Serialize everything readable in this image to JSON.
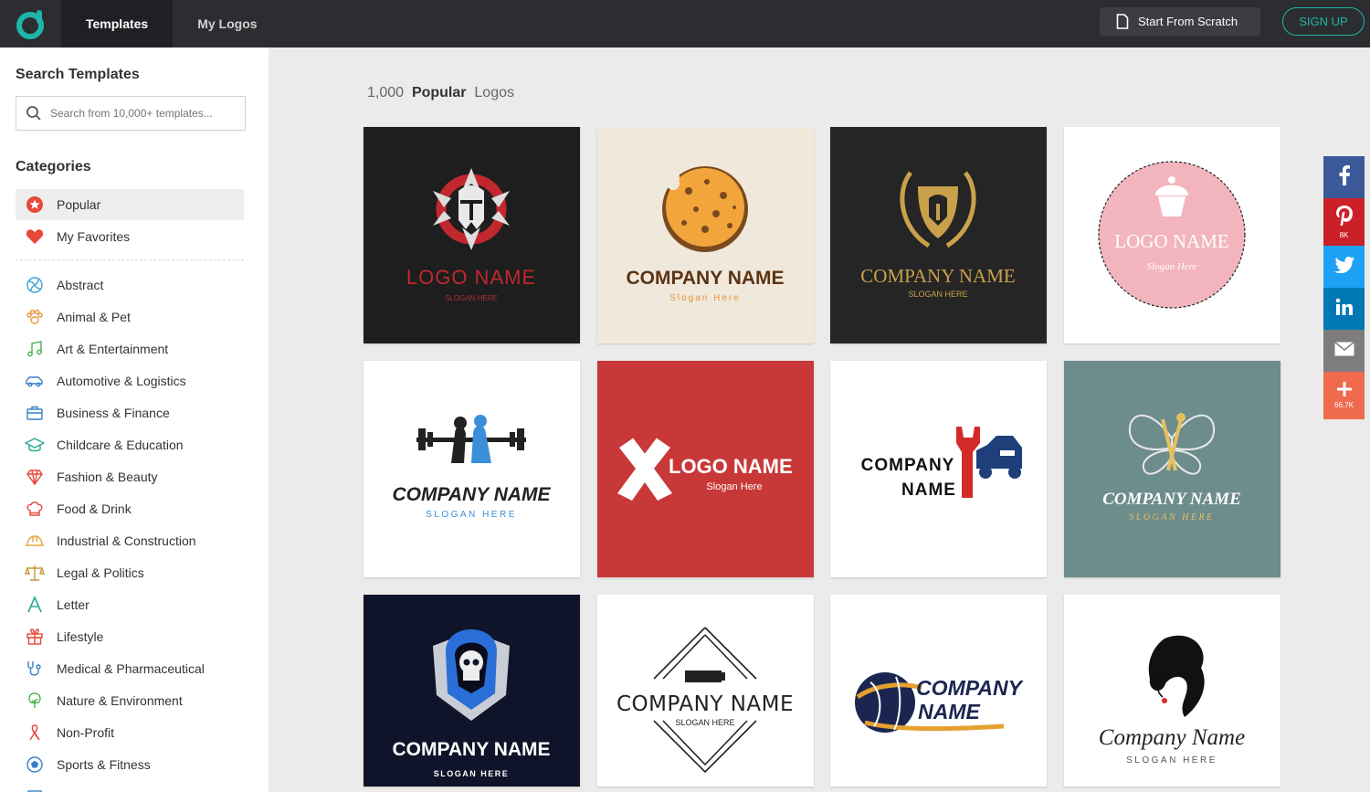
{
  "topbar": {
    "tabs": [
      "Templates",
      "My Logos"
    ],
    "start_from_scratch": "Start From Scratch",
    "sign_up": "SIGN UP",
    "accent": "#1fb5a8"
  },
  "sidebar": {
    "search_title": "Search Templates",
    "search_placeholder": "Search from 10,000+ templates...",
    "categories_title": "Categories",
    "pinned": [
      {
        "label": "Popular",
        "icon": "star-icon",
        "active": true
      },
      {
        "label": "My Favorites",
        "icon": "heart-icon",
        "active": false
      }
    ],
    "categories": [
      {
        "label": "Abstract",
        "icon": "abstract-icon"
      },
      {
        "label": "Animal & Pet",
        "icon": "paw-icon"
      },
      {
        "label": "Art & Entertainment",
        "icon": "music-note-icon"
      },
      {
        "label": "Automotive & Logistics",
        "icon": "car-icon"
      },
      {
        "label": "Business & Finance",
        "icon": "briefcase-icon"
      },
      {
        "label": "Childcare & Education",
        "icon": "graduation-cap-icon"
      },
      {
        "label": "Fashion & Beauty",
        "icon": "diamond-icon"
      },
      {
        "label": "Food & Drink",
        "icon": "chef-hat-icon"
      },
      {
        "label": "Industrial & Construction",
        "icon": "hard-hat-icon"
      },
      {
        "label": "Legal & Politics",
        "icon": "scales-icon"
      },
      {
        "label": "Letter",
        "icon": "letter-a-icon"
      },
      {
        "label": "Lifestyle",
        "icon": "gift-icon"
      },
      {
        "label": "Medical & Pharmaceutical",
        "icon": "stethoscope-icon"
      },
      {
        "label": "Nature & Environment",
        "icon": "tree-icon"
      },
      {
        "label": "Non-Profit",
        "icon": "ribbon-icon"
      },
      {
        "label": "Sports & Fitness",
        "icon": "soccer-ball-icon"
      }
    ]
  },
  "main": {
    "count": "1,000",
    "filter": "Popular",
    "suffix": "Logos",
    "logos": [
      {
        "name": "LOGO NAME",
        "slogan": "SLOGAN HERE",
        "style": "spartan-red",
        "bg": "#1e1e1e"
      },
      {
        "name": "COMPANY NAME",
        "slogan": "Slogan Here",
        "style": "cookie",
        "bg": "#f1e8dc"
      },
      {
        "name": "COMPANY NAME",
        "slogan": "SLOGAN HERE",
        "style": "gold-shield",
        "bg": "#252525"
      },
      {
        "name": "LOGO NAME",
        "slogan": "Slogan Here",
        "style": "cupcake-badge",
        "bg": "#ffffff"
      },
      {
        "name": "COMPANY NAME",
        "slogan": "SLOGAN HERE",
        "style": "fitness",
        "bg": "#ffffff"
      },
      {
        "name": "LOGO NAME",
        "slogan": "Slogan Here",
        "style": "heart-x",
        "bg": "#c93838"
      },
      {
        "name": "COMPANY",
        "name2": "NAME",
        "style": "auto-wrench",
        "bg": "#ffffff"
      },
      {
        "name": "COMPANY NAME",
        "slogan": "SLOGAN HERE",
        "style": "butterfly",
        "bg": "#6d8c8c"
      },
      {
        "name": "COMPANY NAME",
        "slogan": "SLOGAN HERE",
        "style": "skull-hood",
        "bg": "#10142a"
      },
      {
        "name": "COMPANY NAME",
        "slogan": "SLOGAN HERE",
        "style": "usb-diamond",
        "bg": "#ffffff"
      },
      {
        "name": "COMPANY",
        "name2": "NAME",
        "style": "globe",
        "bg": "#ffffff"
      },
      {
        "name": "Company Name",
        "slogan": "SLOGAN HERE",
        "style": "woman-silhouette",
        "bg": "#ffffff"
      }
    ]
  },
  "social": [
    {
      "icon": "facebook-icon",
      "count": "",
      "color": "#3b5998"
    },
    {
      "icon": "pinterest-icon",
      "count": "8K",
      "color": "#cb2027"
    },
    {
      "icon": "twitter-icon",
      "count": "",
      "color": "#1da1f2"
    },
    {
      "icon": "linkedin-icon",
      "count": "",
      "color": "#0077b5"
    },
    {
      "icon": "email-icon",
      "count": "",
      "color": "#7d7d7d"
    },
    {
      "icon": "plus-icon",
      "count": "66.7K",
      "color": "#f06a4e"
    }
  ]
}
